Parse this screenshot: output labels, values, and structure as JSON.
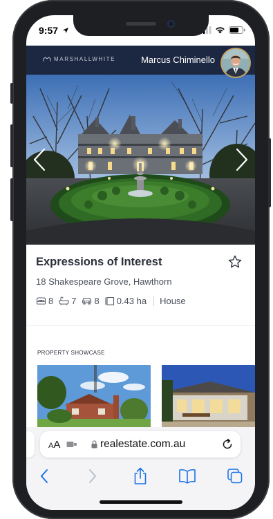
{
  "status_bar": {
    "time": "9:57"
  },
  "site": {
    "logo_text": "MARSHALLWHITE",
    "agent_name": "Marcus Chiminello"
  },
  "listing": {
    "title": "Expressions of Interest",
    "address": "18 Shakespeare Grove, Hawthorn",
    "bedrooms": "8",
    "bathrooms": "7",
    "car_spaces": "8",
    "land_size": "0.43 ha",
    "property_type": "House"
  },
  "showcase": {
    "title": "PROPERTY SHOWCASE"
  },
  "browser": {
    "text_size_label": "A",
    "text_size_label_large": "A",
    "url": "realestate.com.au"
  },
  "colors": {
    "header_bg": "#1c2741",
    "text_dark": "#2a2f3a",
    "ios_blue": "#1a73e8"
  },
  "icons": {
    "status_location": "location-arrow-icon",
    "bed": "bed-icon",
    "bath": "bath-icon",
    "car": "car-icon",
    "land": "land-size-icon",
    "favourite": "star-outline-icon"
  }
}
